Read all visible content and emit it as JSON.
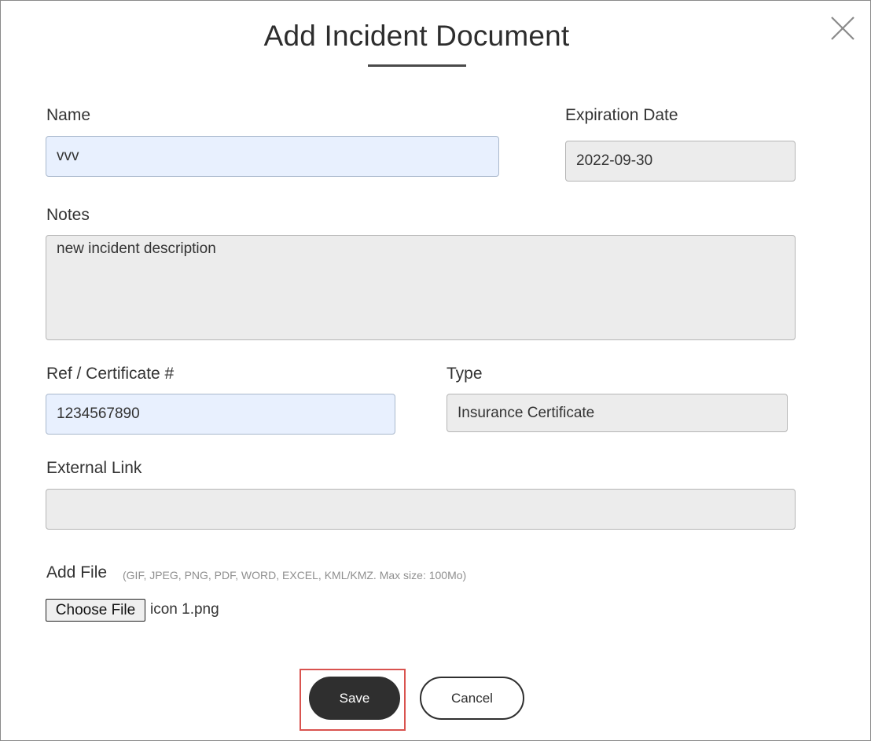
{
  "dialog": {
    "title": "Add Incident Document",
    "close_icon": "close-icon"
  },
  "form": {
    "name": {
      "label": "Name",
      "value": "vvv"
    },
    "expiration_date": {
      "label": "Expiration Date",
      "value": "2022-09-30"
    },
    "notes": {
      "label": "Notes",
      "value": "new incident description"
    },
    "ref_certificate": {
      "label": "Ref / Certificate #",
      "value": "1234567890"
    },
    "type": {
      "label": "Type",
      "value": "Insurance Certificate"
    },
    "external_link": {
      "label": "External Link",
      "value": ""
    },
    "add_file": {
      "label": "Add File",
      "hint": "(GIF, JPEG, PNG, PDF, WORD, EXCEL, KML/KMZ. Max size: 100Mo)",
      "button_label": "Choose File",
      "file_name": "icon 1.png"
    }
  },
  "actions": {
    "save_label": "Save",
    "cancel_label": "Cancel"
  },
  "colors": {
    "autofill_bg": "#e8f0fe",
    "readonly_bg": "#ececec",
    "primary_button": "#2f2f2f",
    "highlight": "#d9534f"
  }
}
